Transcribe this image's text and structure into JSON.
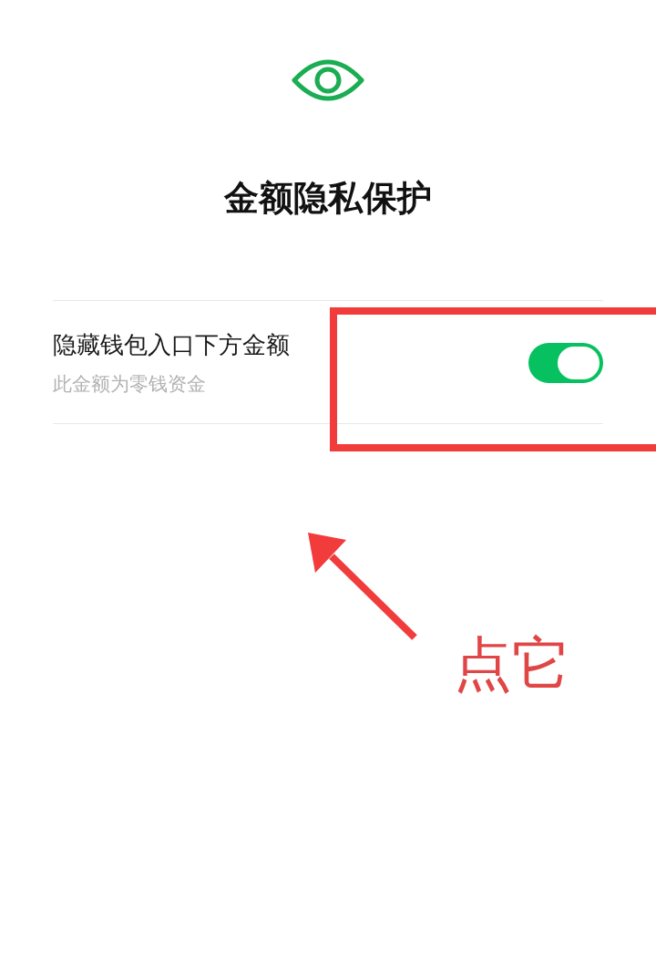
{
  "header": {
    "title": "金额隐私保护"
  },
  "settings": [
    {
      "label": "隐藏钱包入口下方金额",
      "description": "此金额为零钱资金",
      "on": true
    }
  ],
  "annotation": {
    "text": "点它"
  }
}
